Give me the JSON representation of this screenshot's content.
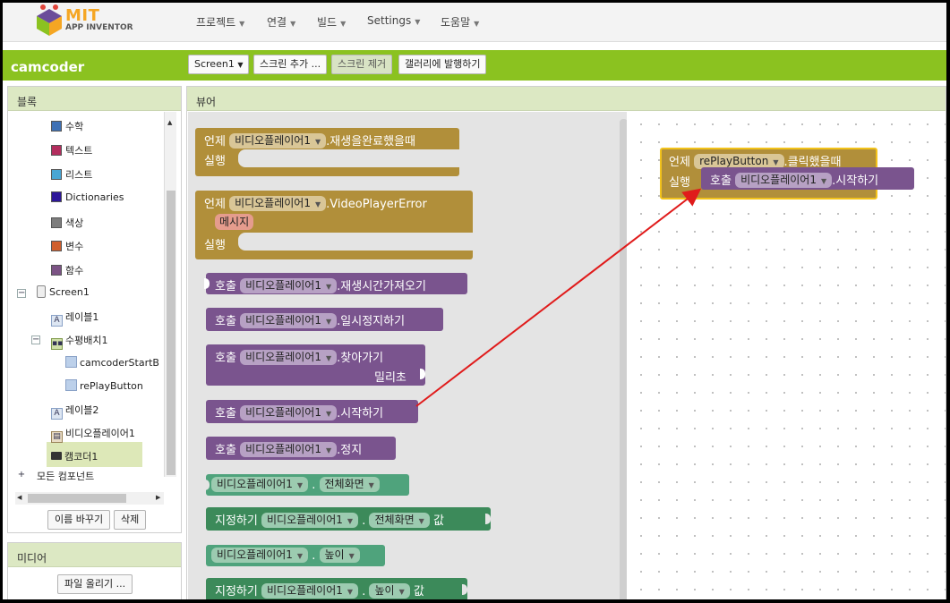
{
  "logo": {
    "line1": "MIT",
    "line2": "APP INVENTOR"
  },
  "menu": [
    {
      "label": "프로젝트"
    },
    {
      "label": "연결"
    },
    {
      "label": "빌드"
    },
    {
      "label": "Settings"
    },
    {
      "label": "도움말"
    }
  ],
  "project": {
    "name": "camcoder",
    "screen_select": "Screen1",
    "add_screen": "스크린 추가 ...",
    "remove_screen": "스크린 제거",
    "publish": "갤러리에 발행하기"
  },
  "blocks_panel": {
    "title": "블록",
    "builtins": [
      {
        "label": "수학",
        "color": "#3f71b5"
      },
      {
        "label": "텍스트",
        "color": "#b32d5e"
      },
      {
        "label": "리스트",
        "color": "#49a6d4"
      },
      {
        "label": "Dictionaries",
        "color": "#2d1799"
      },
      {
        "label": "색상",
        "color": "#7d7d7d"
      },
      {
        "label": "변수",
        "color": "#d05f2d"
      },
      {
        "label": "함수",
        "color": "#7c5385"
      }
    ],
    "components": {
      "screen": "Screen1",
      "label1": "레이블1",
      "hlayout": "수평배치1",
      "start_button": "camcoderStartB",
      "replay_button": "rePlayButton",
      "label2": "레이블2",
      "videoplayer": "비디오플레이어1",
      "camcorder": "캠코더1",
      "all": "모든 컴포넌트"
    },
    "rename_button": "이름 바꾸기",
    "delete_button": "삭제"
  },
  "media_panel": {
    "title": "미디어",
    "upload_button": "파일 올리기 ..."
  },
  "viewer": {
    "title": "뷰어",
    "component": "비디오플레이어1",
    "blocks": {
      "when": "언제",
      "do": "실행",
      "call": "호출",
      "set": "지정하기",
      "to": "값",
      "dot": ".",
      "completed": ".재생을완료했을때",
      "error": ".VideoPlayerError",
      "message": "메시지",
      "get_duration": ".재생시간가져오기",
      "pause": ".일시정지하기",
      "seek": ".찾아가기",
      "ms": "밀리초",
      "start": ".시작하기",
      "stop": ".정지",
      "fullscreen": "전체화면",
      "height": "높이"
    },
    "workspace": {
      "button": "rePlayButton",
      "clicked": ".클릭했을때"
    }
  },
  "colors": {
    "event": "#b18f3a",
    "procedure": "#7a548e",
    "getter_setter": "#3c8a5a",
    "project_bar": "#8bc220",
    "annotation_arrow": "#e01b1b"
  }
}
